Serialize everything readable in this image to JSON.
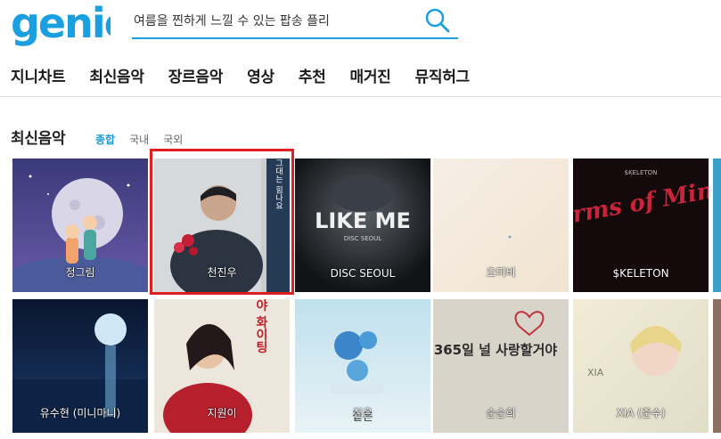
{
  "header": {
    "logo_text": "genie",
    "search_placeholder": "여름을 찐하게 느낄 수 있는 팝송 플리",
    "search_icon": "search-icon"
  },
  "nav": {
    "items": [
      {
        "label": "지니차트"
      },
      {
        "label": "최신음악"
      },
      {
        "label": "장르음악"
      },
      {
        "label": "영상"
      },
      {
        "label": "추천"
      },
      {
        "label": "매거진"
      },
      {
        "label": "뮤직허그"
      }
    ]
  },
  "section": {
    "title": "최신음악",
    "tabs": [
      {
        "label": "종합",
        "active": true
      },
      {
        "label": "국내",
        "active": false
      },
      {
        "label": "국외",
        "active": false
      }
    ]
  },
  "albums": [
    {
      "artist": "정그림"
    },
    {
      "artist": "천진우",
      "cover_text": "이별이 그대는 힘나요"
    },
    {
      "artist": "DISC SEOUL",
      "cover_text": "LIKE ME"
    },
    {
      "artist": "오미비"
    },
    {
      "artist": "$KELETON",
      "cover_text": "Arms of Mine"
    },
    {
      "artist": "유수현 (미니마니)"
    },
    {
      "artist": "지원이",
      "cover_text": "자기야 화이팅"
    },
    {
      "artist": "짙은",
      "cover_text": "짙은"
    },
    {
      "artist": "순순희",
      "cover_text": "365일 널 사랑할거야"
    },
    {
      "artist": "XIA (준수)",
      "cover_text": "XIA"
    }
  ],
  "colors": {
    "accent": "#1a9ad8",
    "logo": "#1aa0e0",
    "highlight": "#e02020"
  }
}
